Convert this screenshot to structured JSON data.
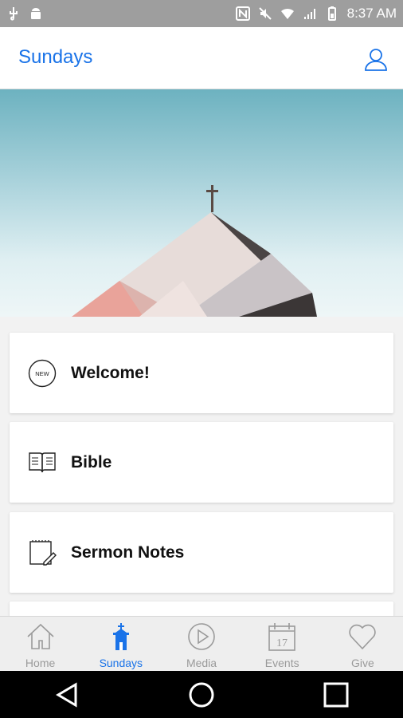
{
  "status_bar": {
    "time": "8:37 AM"
  },
  "header": {
    "title": "Sundays"
  },
  "cards": [
    {
      "label": "Welcome!",
      "icon": "new-badge-icon",
      "badge_text": "NEW"
    },
    {
      "label": "Bible",
      "icon": "open-book-icon"
    },
    {
      "label": "Sermon Notes",
      "icon": "notepad-pencil-icon"
    }
  ],
  "tabs": [
    {
      "label": "Home",
      "icon": "home-icon",
      "active": false
    },
    {
      "label": "Sundays",
      "icon": "church-icon",
      "active": true
    },
    {
      "label": "Media",
      "icon": "play-circle-icon",
      "active": false
    },
    {
      "label": "Events",
      "icon": "calendar-icon",
      "active": false,
      "date_number": "17"
    },
    {
      "label": "Give",
      "icon": "heart-icon",
      "active": false
    }
  ],
  "colors": {
    "accent": "#1a73e8",
    "status_bar": "#9e9e9e",
    "tab_inactive": "#9a9a9a"
  }
}
